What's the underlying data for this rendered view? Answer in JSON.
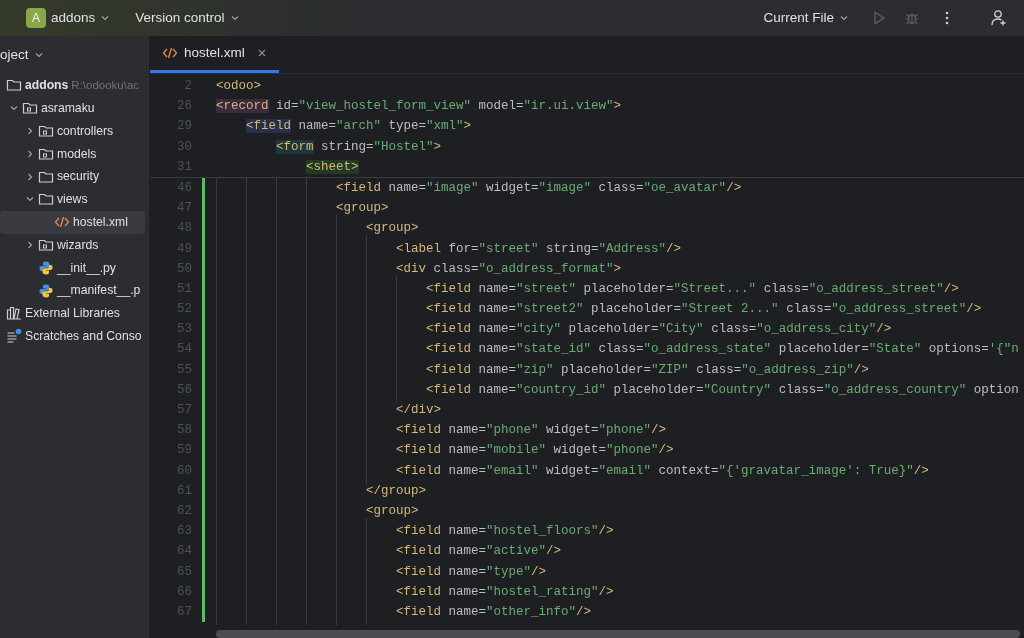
{
  "top_bar": {
    "project_badge": "A",
    "project": "addons",
    "vcs": "Version control",
    "run_config": "Current File"
  },
  "sidebar": {
    "header": "oject",
    "tree": [
      {
        "label": "addons",
        "kind": "folder",
        "hint": "R:\\odooku\\ac",
        "selected": false,
        "children": [
          {
            "label": "asramaku",
            "kind": "module",
            "expanded": true,
            "selected": false,
            "children": [
              {
                "label": "controllers",
                "kind": "module",
                "expanded": false,
                "selected": false
              },
              {
                "label": "models",
                "kind": "module",
                "expanded": false,
                "selected": false
              },
              {
                "label": "security",
                "kind": "folder",
                "expanded": false,
                "selected": false
              },
              {
                "label": "views",
                "kind": "folder",
                "expanded": true,
                "selected": false,
                "children": [
                  {
                    "label": "hostel.xml",
                    "kind": "xml",
                    "selected": true
                  }
                ]
              },
              {
                "label": "wizards",
                "kind": "module",
                "expanded": false,
                "selected": false
              },
              {
                "label": "__init__.py",
                "kind": "python",
                "selected": false
              },
              {
                "label": "__manifest__.p",
                "kind": "python",
                "selected": false
              }
            ]
          }
        ]
      },
      {
        "label": "External Libraries",
        "kind": "libraries",
        "selected": false
      },
      {
        "label": "Scratches and Conso",
        "kind": "scratches",
        "selected": false
      }
    ]
  },
  "tabs": [
    {
      "label": "hostel.xml",
      "kind": "xml",
      "selected": true
    }
  ],
  "editor": {
    "sticky_lines": [
      {
        "number": "2",
        "text": [
          {
            "kind": "tag",
            "text": "<odoo>"
          }
        ]
      },
      {
        "number": "26",
        "text": [
          {
            "kind": "tag",
            "text": "<record",
            "color": "#3d2a3f"
          },
          {
            "kind": "attr",
            "text": " id="
          },
          {
            "kind": "str",
            "text": "\"view_hostel_form_view\""
          },
          {
            "kind": "attr",
            "text": " model="
          },
          {
            "kind": "str",
            "text": "\"ir.ui.view\""
          },
          {
            "kind": "tag",
            "text": ">"
          }
        ],
        "children": [
          {
            "number": "29",
            "text": [
              {
                "kind": "tag",
                "text": "<field",
                "color": "#26304a"
              },
              {
                "kind": "attr",
                "text": " name="
              },
              {
                "kind": "str",
                "text": "\"arch\""
              },
              {
                "kind": "attr",
                "text": " type="
              },
              {
                "kind": "str",
                "text": "\"xml\""
              },
              {
                "kind": "tag",
                "text": ">"
              }
            ],
            "children": [
              {
                "number": "30",
                "text": [
                  {
                    "kind": "tag",
                    "text": "<form",
                    "color": "#1d3838"
                  },
                  {
                    "kind": "attr",
                    "text": " string="
                  },
                  {
                    "kind": "str",
                    "text": "\"Hostel\""
                  },
                  {
                    "kind": "tag",
                    "text": ">"
                  }
                ],
                "children": [
                  {
                    "number": "31",
                    "text": [
                      {
                        "kind": "tag",
                        "text": "<sheet>",
                        "color": "#233a22"
                      }
                    ]
                  }
                ]
              }
            ]
          }
        ]
      }
    ],
    "lines": [
      {
        "number": "46",
        "modified": true,
        "text": [
          {
            "kind": "tag",
            "text": "<field"
          },
          {
            "kind": "attr",
            "text": " name="
          },
          {
            "kind": "str",
            "text": "\"image\""
          },
          {
            "kind": "attr",
            "text": " widget="
          },
          {
            "kind": "str",
            "text": "\"image\""
          },
          {
            "kind": "attr",
            "text": " class="
          },
          {
            "kind": "str",
            "text": "\"oe_avatar\""
          },
          {
            "kind": "tag",
            "text": "/>"
          }
        ]
      },
      {
        "number": "47",
        "modified": true,
        "text": [
          {
            "kind": "tag",
            "text": "<group>"
          }
        ],
        "children": [
          {
            "number": "48",
            "modified": true,
            "text": [
              {
                "kind": "tag",
                "text": "<group>"
              }
            ],
            "children": [
              {
                "number": "49",
                "modified": true,
                "text": [
                  {
                    "kind": "tag",
                    "text": "<label"
                  },
                  {
                    "kind": "attr",
                    "text": " for="
                  },
                  {
                    "kind": "str",
                    "text": "\"street\""
                  },
                  {
                    "kind": "attr",
                    "text": " string="
                  },
                  {
                    "kind": "str",
                    "text": "\"Address\""
                  },
                  {
                    "kind": "tag",
                    "text": "/>"
                  }
                ]
              },
              {
                "number": "50",
                "modified": true,
                "text": [
                  {
                    "kind": "tag",
                    "text": "<div"
                  },
                  {
                    "kind": "attr",
                    "text": " class="
                  },
                  {
                    "kind": "str",
                    "text": "\"o_address_format\""
                  },
                  {
                    "kind": "tag",
                    "text": ">"
                  }
                ],
                "children": [
                  {
                    "number": "51",
                    "modified": true,
                    "text": [
                      {
                        "kind": "tag",
                        "text": "<field"
                      },
                      {
                        "kind": "attr",
                        "text": " name="
                      },
                      {
                        "kind": "str",
                        "text": "\"street\""
                      },
                      {
                        "kind": "attr",
                        "text": " placeholder="
                      },
                      {
                        "kind": "str",
                        "text": "\"Street...\""
                      },
                      {
                        "kind": "attr",
                        "text": " class="
                      },
                      {
                        "kind": "str",
                        "text": "\"o_address_street\""
                      },
                      {
                        "kind": "tag",
                        "text": "/>"
                      }
                    ]
                  },
                  {
                    "number": "52",
                    "modified": true,
                    "text": [
                      {
                        "kind": "tag",
                        "text": "<field"
                      },
                      {
                        "kind": "attr",
                        "text": " name="
                      },
                      {
                        "kind": "str",
                        "text": "\"street2\""
                      },
                      {
                        "kind": "attr",
                        "text": " placeholder="
                      },
                      {
                        "kind": "str",
                        "text": "\"Street 2...\""
                      },
                      {
                        "kind": "attr",
                        "text": " class="
                      },
                      {
                        "kind": "str",
                        "text": "\"o_address_street\""
                      },
                      {
                        "kind": "tag",
                        "text": "/>"
                      }
                    ]
                  },
                  {
                    "number": "53",
                    "modified": true,
                    "text": [
                      {
                        "kind": "tag",
                        "text": "<field"
                      },
                      {
                        "kind": "attr",
                        "text": " name="
                      },
                      {
                        "kind": "str",
                        "text": "\"city\""
                      },
                      {
                        "kind": "attr",
                        "text": " placeholder="
                      },
                      {
                        "kind": "str",
                        "text": "\"City\""
                      },
                      {
                        "kind": "attr",
                        "text": " class="
                      },
                      {
                        "kind": "str",
                        "text": "\"o_address_city\""
                      },
                      {
                        "kind": "tag",
                        "text": "/>"
                      }
                    ]
                  },
                  {
                    "number": "54",
                    "modified": true,
                    "text": [
                      {
                        "kind": "tag",
                        "text": "<field"
                      },
                      {
                        "kind": "attr",
                        "text": " name="
                      },
                      {
                        "kind": "str",
                        "text": "\"state_id\""
                      },
                      {
                        "kind": "attr",
                        "text": " class="
                      },
                      {
                        "kind": "str",
                        "text": "\"o_address_state\""
                      },
                      {
                        "kind": "attr",
                        "text": " placeholder="
                      },
                      {
                        "kind": "str",
                        "text": "\"State\""
                      },
                      {
                        "kind": "attr",
                        "text": " options="
                      },
                      {
                        "kind": "str",
                        "text": "'{\"n"
                      }
                    ]
                  },
                  {
                    "number": "55",
                    "modified": true,
                    "text": [
                      {
                        "kind": "tag",
                        "text": "<field"
                      },
                      {
                        "kind": "attr",
                        "text": " name="
                      },
                      {
                        "kind": "str",
                        "text": "\"zip\""
                      },
                      {
                        "kind": "attr",
                        "text": " placeholder="
                      },
                      {
                        "kind": "str",
                        "text": "\"ZIP\""
                      },
                      {
                        "kind": "attr",
                        "text": " class="
                      },
                      {
                        "kind": "str",
                        "text": "\"o_address_zip\""
                      },
                      {
                        "kind": "tag",
                        "text": "/>"
                      }
                    ]
                  },
                  {
                    "number": "56",
                    "modified": true,
                    "text": [
                      {
                        "kind": "tag",
                        "text": "<field"
                      },
                      {
                        "kind": "attr",
                        "text": " name="
                      },
                      {
                        "kind": "str",
                        "text": "\"country_id\""
                      },
                      {
                        "kind": "attr",
                        "text": " placeholder="
                      },
                      {
                        "kind": "str",
                        "text": "\"Country\""
                      },
                      {
                        "kind": "attr",
                        "text": " class="
                      },
                      {
                        "kind": "str",
                        "text": "\"o_address_country\""
                      },
                      {
                        "kind": "attr",
                        "text": " option"
                      }
                    ]
                  }
                ]
              },
              {
                "number": "57",
                "modified": true,
                "text": [
                  {
                    "kind": "tag",
                    "text": "</div>"
                  }
                ]
              },
              {
                "number": "58",
                "modified": true,
                "text": [
                  {
                    "kind": "tag",
                    "text": "<field"
                  },
                  {
                    "kind": "attr",
                    "text": " name="
                  },
                  {
                    "kind": "str",
                    "text": "\"phone\""
                  },
                  {
                    "kind": "attr",
                    "text": " widget="
                  },
                  {
                    "kind": "str",
                    "text": "\"phone\""
                  },
                  {
                    "kind": "tag",
                    "text": "/>"
                  }
                ]
              },
              {
                "number": "59",
                "modified": true,
                "text": [
                  {
                    "kind": "tag",
                    "text": "<field"
                  },
                  {
                    "kind": "attr",
                    "text": " name="
                  },
                  {
                    "kind": "str",
                    "text": "\"mobile\""
                  },
                  {
                    "kind": "attr",
                    "text": " widget="
                  },
                  {
                    "kind": "str",
                    "text": "\"phone\""
                  },
                  {
                    "kind": "tag",
                    "text": "/>"
                  }
                ]
              },
              {
                "number": "60",
                "modified": true,
                "text": [
                  {
                    "kind": "tag",
                    "text": "<field"
                  },
                  {
                    "kind": "attr",
                    "text": " name="
                  },
                  {
                    "kind": "str",
                    "text": "\"email\""
                  },
                  {
                    "kind": "attr",
                    "text": " widget="
                  },
                  {
                    "kind": "str",
                    "text": "\"email\""
                  },
                  {
                    "kind": "attr",
                    "text": " context="
                  },
                  {
                    "kind": "str",
                    "text": "\"{'gravatar_image': True}\""
                  },
                  {
                    "kind": "tag",
                    "text": "/>"
                  }
                ]
              }
            ]
          },
          {
            "number": "61",
            "modified": true,
            "text": [
              {
                "kind": "tag",
                "text": "</group>"
              }
            ]
          },
          {
            "number": "62",
            "modified": true,
            "text": [
              {
                "kind": "tag",
                "text": "<group>"
              }
            ],
            "children": [
              {
                "number": "63",
                "modified": true,
                "text": [
                  {
                    "kind": "tag",
                    "text": "<field"
                  },
                  {
                    "kind": "attr",
                    "text": " name="
                  },
                  {
                    "kind": "str",
                    "text": "\"hostel_floors\""
                  },
                  {
                    "kind": "tag",
                    "text": "/>"
                  }
                ]
              },
              {
                "number": "64",
                "modified": true,
                "text": [
                  {
                    "kind": "tag",
                    "text": "<field"
                  },
                  {
                    "kind": "attr",
                    "text": " name="
                  },
                  {
                    "kind": "str",
                    "text": "\"active\""
                  },
                  {
                    "kind": "tag",
                    "text": "/>"
                  }
                ]
              },
              {
                "number": "65",
                "modified": true,
                "text": [
                  {
                    "kind": "tag",
                    "text": "<field"
                  },
                  {
                    "kind": "attr",
                    "text": " name="
                  },
                  {
                    "kind": "str",
                    "text": "\"type\""
                  },
                  {
                    "kind": "tag",
                    "text": "/>"
                  }
                ]
              },
              {
                "number": "66",
                "modified": true,
                "text": [
                  {
                    "kind": "tag",
                    "text": "<field"
                  },
                  {
                    "kind": "attr",
                    "text": " name="
                  },
                  {
                    "kind": "str",
                    "text": "\"hostel_rating\""
                  },
                  {
                    "kind": "tag",
                    "text": "/>"
                  }
                ]
              },
              {
                "number": "67",
                "modified": true,
                "text": [
                  {
                    "kind": "tag",
                    "text": "<field"
                  },
                  {
                    "kind": "attr",
                    "text": " name="
                  },
                  {
                    "kind": "str",
                    "text": "\"other_info\""
                  },
                  {
                    "kind": "tag",
                    "text": "/>"
                  }
                ]
              }
            ]
          }
        ]
      }
    ]
  }
}
